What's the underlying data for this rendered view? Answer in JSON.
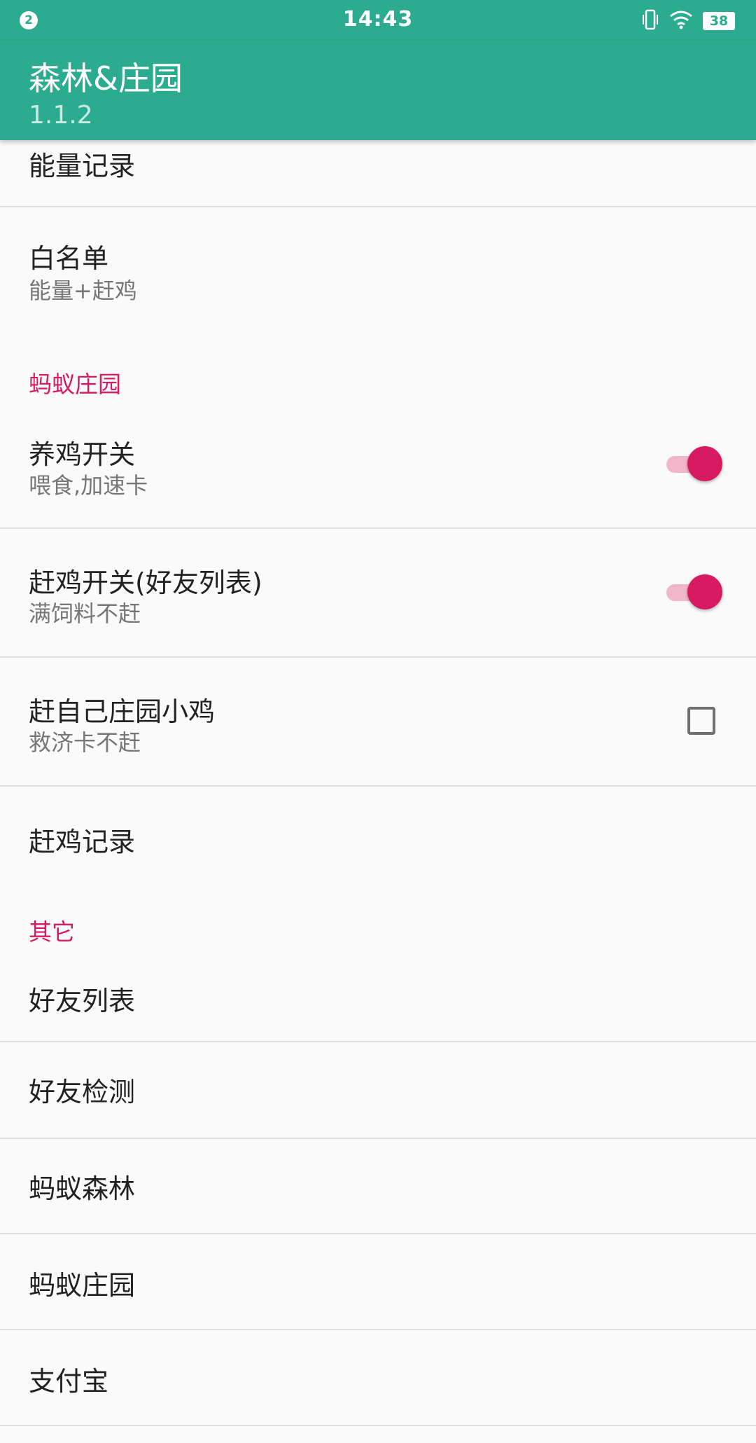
{
  "status_bar": {
    "notification_count": "2",
    "time": "14:43",
    "battery": "38",
    "icons": [
      "vibrate-icon",
      "wifi-icon",
      "battery-icon"
    ]
  },
  "toolbar": {
    "title": "森林&庄园",
    "version": "1.1.2"
  },
  "colors": {
    "primary": "#2bab8f",
    "accent": "#d81b60",
    "background": "#fafafa"
  },
  "prefs": {
    "energy_log": {
      "title": "能量记录"
    },
    "whitelist": {
      "title": "白名单",
      "summary": "能量+赶鸡"
    },
    "category_farm": "蚂蚁庄园",
    "chicken_switch": {
      "title": "养鸡开关",
      "summary": "喂食,加速卡",
      "checked": true
    },
    "drive_switch": {
      "title": "赶鸡开关(好友列表)",
      "summary": "满饲料不赶",
      "checked": true
    },
    "drive_own": {
      "title": "赶自己庄园小鸡",
      "summary": "救济卡不赶",
      "checked": false
    },
    "drive_log": {
      "title": "赶鸡记录"
    },
    "category_other": "其它",
    "friend_list": {
      "title": "好友列表"
    },
    "friend_check": {
      "title": "好友检测"
    },
    "ant_forest": {
      "title": "蚂蚁森林"
    },
    "ant_farm": {
      "title": "蚂蚁庄园"
    },
    "alipay": {
      "title": "支付宝"
    }
  }
}
